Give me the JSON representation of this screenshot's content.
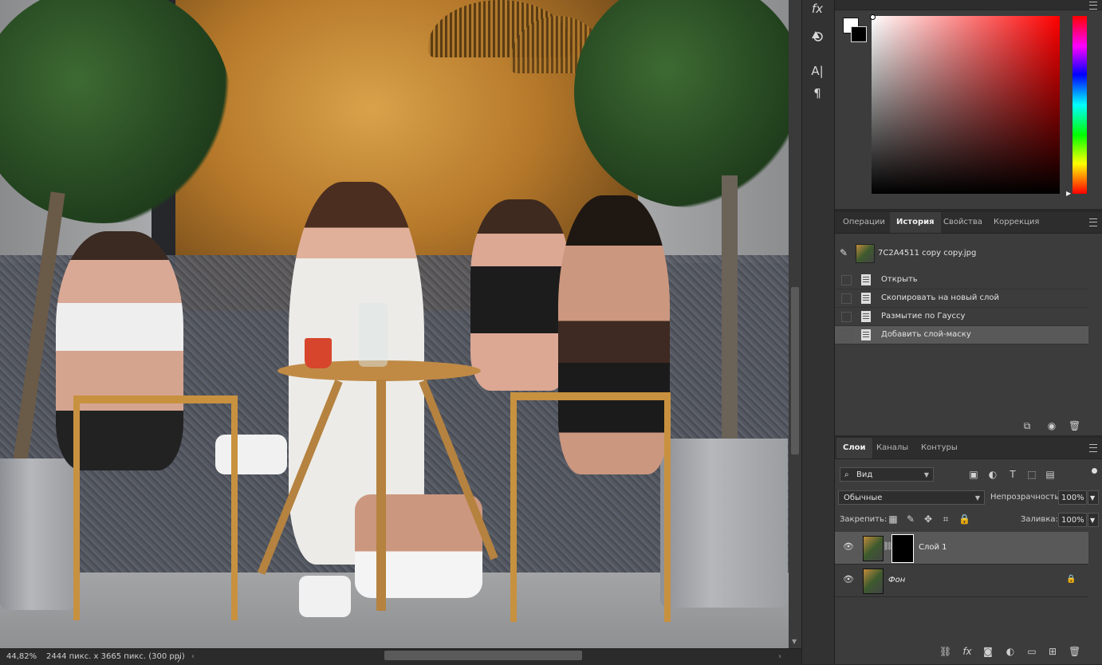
{
  "status_bar": {
    "zoom": "44,82%",
    "doc_info": "2444 пикс. x 3665 пикс. (300 ppi)",
    "arrow": "〉"
  },
  "toolstrip": {
    "fx": "fx",
    "type": "A|",
    "para": "¶"
  },
  "color_panel": {
    "foreground": "#ffffff",
    "background": "#000000"
  },
  "history_panel": {
    "tabs": [
      "Операции",
      "История",
      "Свойства",
      "Коррекция"
    ],
    "active_tab": "История",
    "snapshot_name": "7C2A4511 copy copy.jpg",
    "steps": [
      "Открыть",
      "Скопировать на новый слой",
      "Размытие по Гауссу",
      "Добавить слой-маску"
    ],
    "selected_step": 3
  },
  "layers_panel": {
    "tabs": [
      "Слои",
      "Каналы",
      "Контуры"
    ],
    "active_tab": "Слои",
    "filter_value": "Вид",
    "blend_mode": "Обычные",
    "opacity_label": "Непрозрачность:",
    "opacity_value": "100%",
    "lock_label": "Закрепить:",
    "fill_label": "Заливка:",
    "fill_value": "100%",
    "layers": [
      {
        "name": "Слой 1",
        "has_mask": true,
        "selected": true,
        "locked": false
      },
      {
        "name": "Фон",
        "has_mask": false,
        "selected": false,
        "locked": true
      }
    ]
  }
}
